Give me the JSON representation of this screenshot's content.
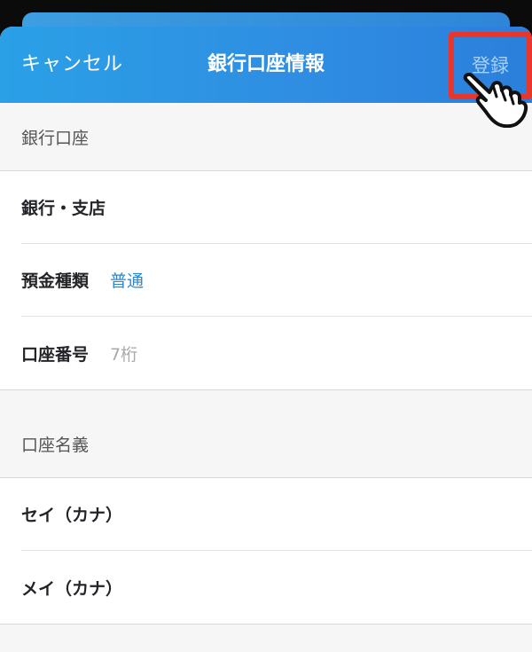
{
  "nav": {
    "cancel_label": "キャンセル",
    "title": "銀行口座情報",
    "register_label": "登録"
  },
  "section_bank": {
    "header": "銀行口座",
    "rows": [
      {
        "label": "銀行・支店",
        "value": ""
      },
      {
        "label": "預金種類",
        "value": "普通"
      },
      {
        "label": "口座番号",
        "placeholder": "7桁"
      }
    ]
  },
  "section_name": {
    "header": "口座名義",
    "rows": [
      {
        "label": "セイ（カナ）"
      },
      {
        "label": "メイ（カナ）"
      }
    ]
  },
  "colors": {
    "accent": "#2b87d1",
    "highlight": "#e8362c",
    "navbar": "#2f8ee2"
  },
  "icons": {
    "pointer": "pointing-hand-icon"
  }
}
